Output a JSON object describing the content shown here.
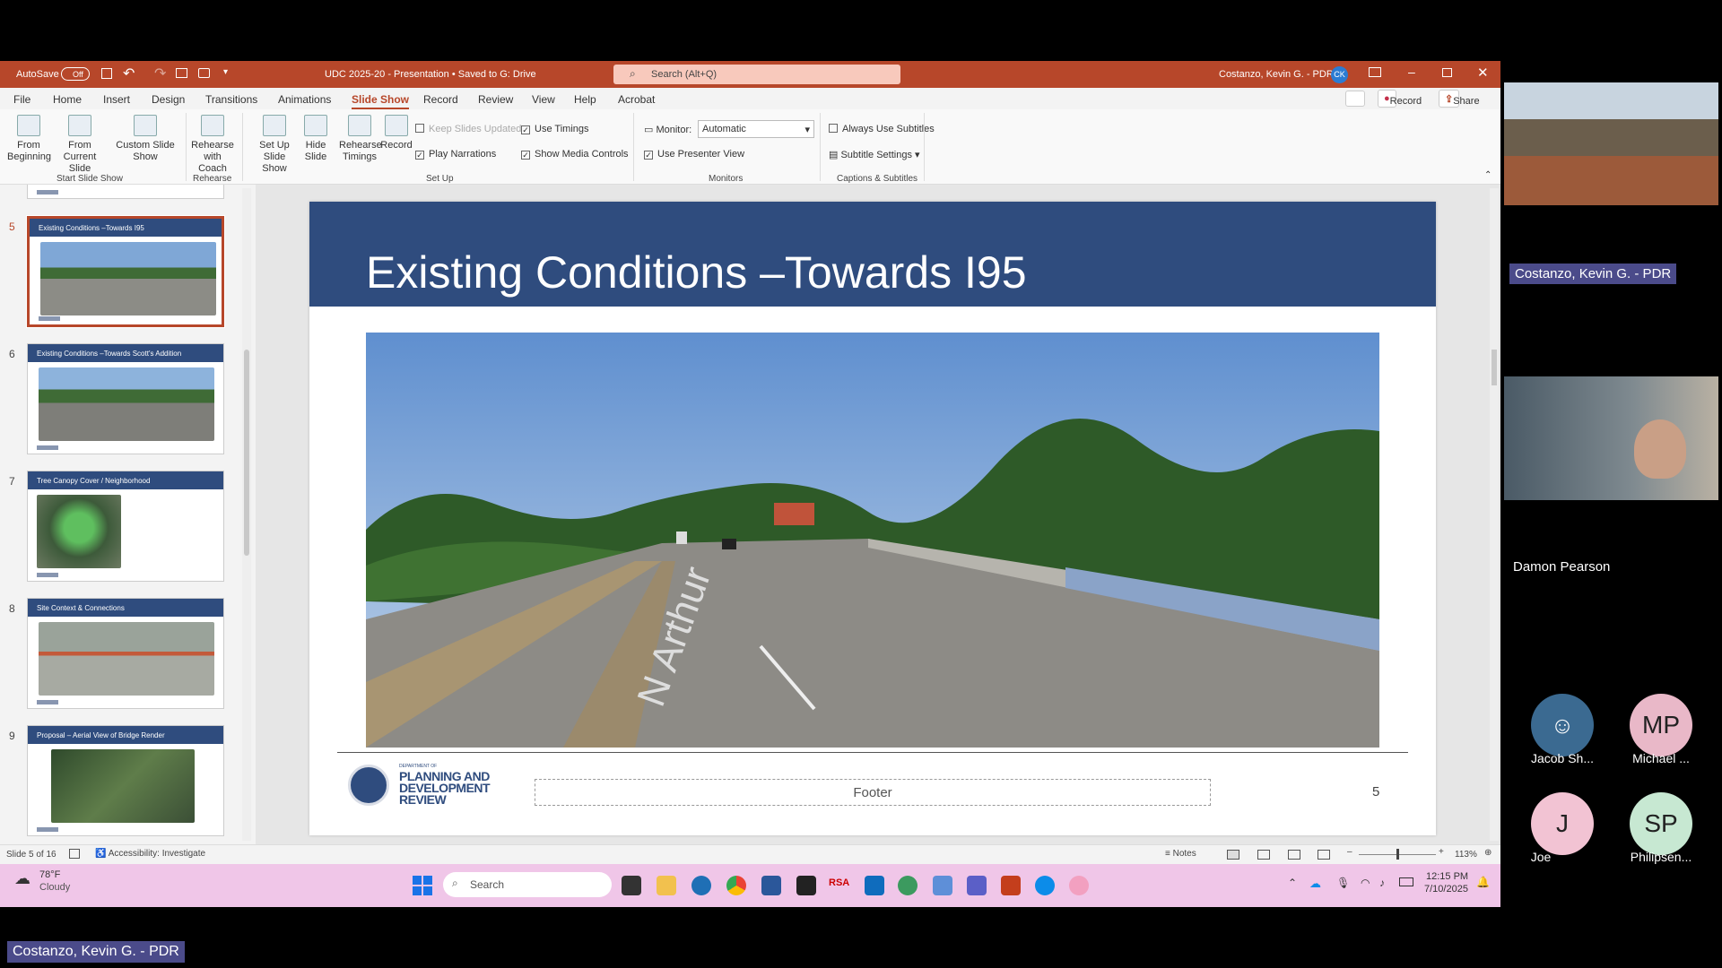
{
  "window": {
    "autosave_label": "AutoSave",
    "autosave_state": "Off",
    "doc_title": "UDC 2025-20 - Presentation • Saved to G: Drive",
    "search_placeholder": "Search (Alt+Q)",
    "user_name": "Costanzo, Kevin G. - PDR",
    "user_initials": "CK"
  },
  "tabs": [
    "File",
    "Home",
    "Insert",
    "Design",
    "Transitions",
    "Animations",
    "Slide Show",
    "Record",
    "Review",
    "View",
    "Help",
    "Acrobat"
  ],
  "active_tab": "Slide Show",
  "record_button": "Record",
  "share_button": "Share",
  "ribbon": {
    "from_beginning": "From Beginning",
    "from_current": "From Current Slide",
    "custom_show": "Custom Slide Show",
    "group_start": "Start Slide Show",
    "rehearse_coach": "Rehearse with Coach",
    "group_rehearse": "Rehearse",
    "setup_show": "Set Up Slide Show",
    "hide_slide": "Hide Slide",
    "rehearse_timings": "Rehearse Timings",
    "record": "Record",
    "keep_updated": "Keep Slides Updated",
    "use_timings": "Use Timings",
    "play_narrations": "Play Narrations",
    "show_media": "Show Media Controls",
    "group_setup": "Set Up",
    "monitor_label": "Monitor:",
    "monitor_value": "Automatic",
    "presenter_view": "Use Presenter View",
    "group_monitors": "Monitors",
    "always_subtitles": "Always Use Subtitles",
    "subtitle_settings": "Subtitle Settings",
    "group_captions": "Captions & Subtitles"
  },
  "thumbnails": [
    {
      "num": "5",
      "title": "Existing Conditions –Towards I95"
    },
    {
      "num": "6",
      "title": "Existing Conditions –Towards Scott's Addition"
    },
    {
      "num": "7",
      "title": "Tree Canopy Cover / Neighborhood"
    },
    {
      "num": "8",
      "title": "Site Context & Connections"
    },
    {
      "num": "9",
      "title": "Proposal – Aerial View of Bridge Render"
    }
  ],
  "slide": {
    "title": "Existing Conditions –Towards I95",
    "footer": "Footer",
    "number": "5",
    "logo_dept": "DEPARTMENT OF",
    "logo_l1": "PLANNING AND",
    "logo_l2": "DEVELOPMENT",
    "logo_l3": "REVIEW"
  },
  "status": {
    "slide_of": "Slide 5 of 16",
    "accessibility": "Accessibility: Investigate",
    "notes": "Notes",
    "zoom": "113%"
  },
  "taskbar": {
    "temp": "78°F",
    "weather": "Cloudy",
    "search": "Search",
    "time": "12:15 PM",
    "date": "7/10/2025"
  },
  "participants": {
    "presenter_tag": "Costanzo, Kevin G. - PDR",
    "video2_name": "Damon Pearson",
    "bottom_tag": "Costanzo, Kevin G. - PDR",
    "people": [
      {
        "initials": "",
        "name": "Jacob Sh..."
      },
      {
        "initials": "MP",
        "name": "Michael ..."
      },
      {
        "initials": "J",
        "name": "Joe"
      },
      {
        "initials": "SP",
        "name": "Philipsen..."
      }
    ]
  }
}
